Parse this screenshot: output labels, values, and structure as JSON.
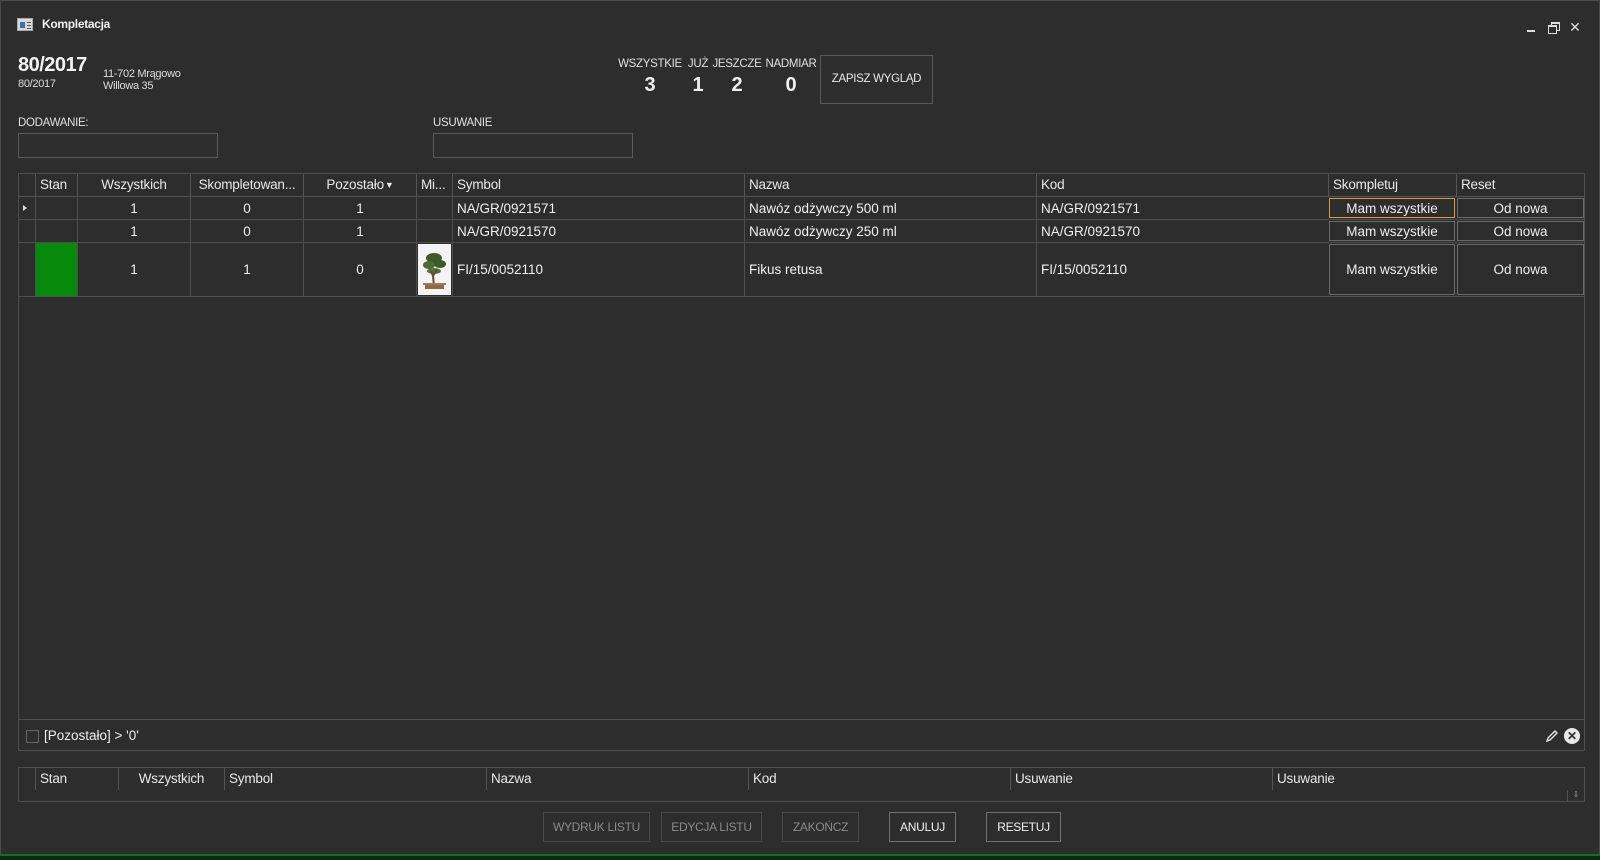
{
  "window": {
    "title": "Kompletacja"
  },
  "header": {
    "order_number": "80/2017",
    "order_sub": "80/2017",
    "address_line1": "11-702 Mrągowo",
    "address_line2": "Willowa 35"
  },
  "stats": [
    {
      "label": "WSZYSTKIE",
      "value": "3"
    },
    {
      "label": "JUŻ",
      "value": "1"
    },
    {
      "label": "JESZCZE",
      "value": "2"
    },
    {
      "label": "NADMIAR",
      "value": "0"
    }
  ],
  "save_layout_label": "ZAPISZ WYGLĄD",
  "fields": {
    "adding_label": "DODAWANIE:",
    "adding_value": "",
    "removing_label": "USUWANIE",
    "removing_value": ""
  },
  "grid": {
    "columns": [
      "Stan",
      "Wszystkich",
      "Skompletowan...",
      "Pozostało",
      "Mi...",
      "Symbol",
      "Nazwa",
      "Kod",
      "Skompletuj",
      "Reset"
    ],
    "rows": [
      {
        "stan": "",
        "wszystkich": "1",
        "skompletowane": "0",
        "pozostalo": "1",
        "symbol": "NA/GR/0921571",
        "nazwa": "Nawóz odżywczy 500 ml",
        "kod": "NA/GR/0921571",
        "skompletuj": "Mam wszystkie",
        "reset": "Od nowa",
        "current": true,
        "complete": false,
        "image": false
      },
      {
        "stan": "",
        "wszystkich": "1",
        "skompletowane": "0",
        "pozostalo": "1",
        "symbol": "NA/GR/0921570",
        "nazwa": "Nawóz odżywczy 250 ml",
        "kod": "NA/GR/0921570",
        "skompletuj": "Mam wszystkie",
        "reset": "Od nowa",
        "current": false,
        "complete": false,
        "image": false
      },
      {
        "stan": "",
        "wszystkich": "1",
        "skompletowane": "1",
        "pozostalo": "0",
        "symbol": "FI/15/0052110",
        "nazwa": "Fikus retusa",
        "kod": "FI/15/0052110",
        "skompletuj": "Mam wszystkie",
        "reset": "Od nowa",
        "current": false,
        "complete": true,
        "image": true
      }
    ],
    "filter_text": "[Pozostało] > '0'",
    "complete_color": "#078a0b"
  },
  "removed_grid": {
    "columns": [
      "Stan",
      "Wszystkich",
      "Symbol",
      "Nazwa",
      "Kod",
      "Usuwanie",
      "Usuwanie"
    ]
  },
  "buttons": {
    "print": "WYDRUK LISTU",
    "edit": "EDYCJA LISTU",
    "finish": "ZAKOŃCZ",
    "cancel": "ANULUJ",
    "reset": "RESETUJ"
  }
}
